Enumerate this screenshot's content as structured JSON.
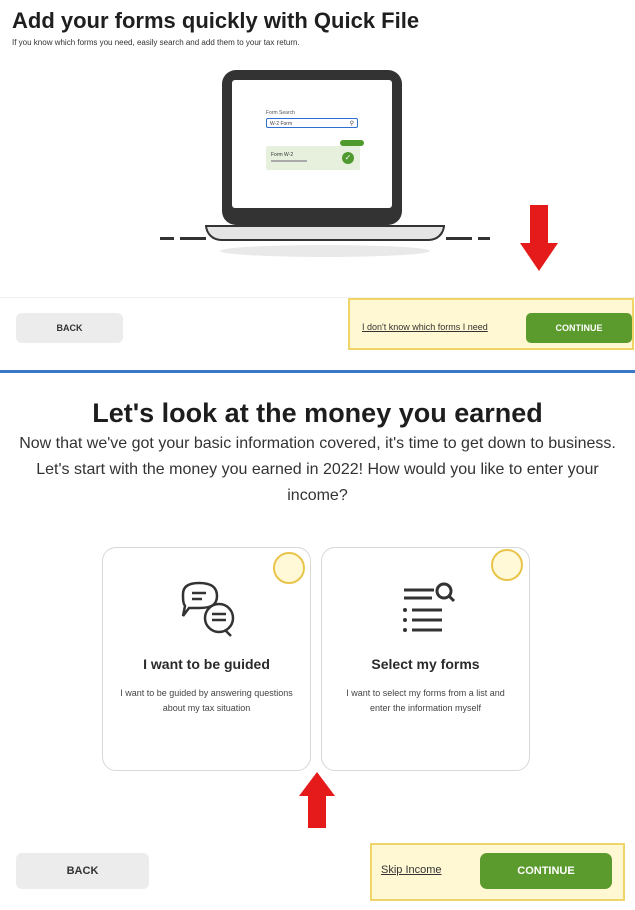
{
  "top": {
    "title": "Add your forms quickly with Quick File",
    "subtitle": "If you know which forms you need, easily search and add them to your tax return.",
    "illustration": {
      "search_label": "Form Search",
      "search_value": "W-2 Form",
      "result_title": "Form W-2"
    },
    "back_label": "BACK",
    "link_label": "I don't know which forms I need",
    "continue_label": "CONTINUE"
  },
  "bottom": {
    "title": "Let's look at the money you earned",
    "body": "Now that we've got your basic information covered, it's time to get down to business. Let's start with the money you earned in 2022! How would you like to enter your income?",
    "cards": [
      {
        "title": "I want to be guided",
        "description": "I want to be guided by answering questions about my tax situation",
        "icon": "chat-bubbles-icon"
      },
      {
        "title": "Select my forms",
        "description": "I want to select my forms from a list and enter the information myself",
        "icon": "list-search-icon"
      }
    ],
    "back_label": "BACK",
    "skip_label": "Skip Income",
    "continue_label": "CONTINUE"
  },
  "colors": {
    "accent_green": "#5b9a2c",
    "highlight_fill": "#fff8d3",
    "highlight_border": "#efd46a",
    "divider_blue": "#3c78c8",
    "arrow_red": "#e51a1a"
  }
}
